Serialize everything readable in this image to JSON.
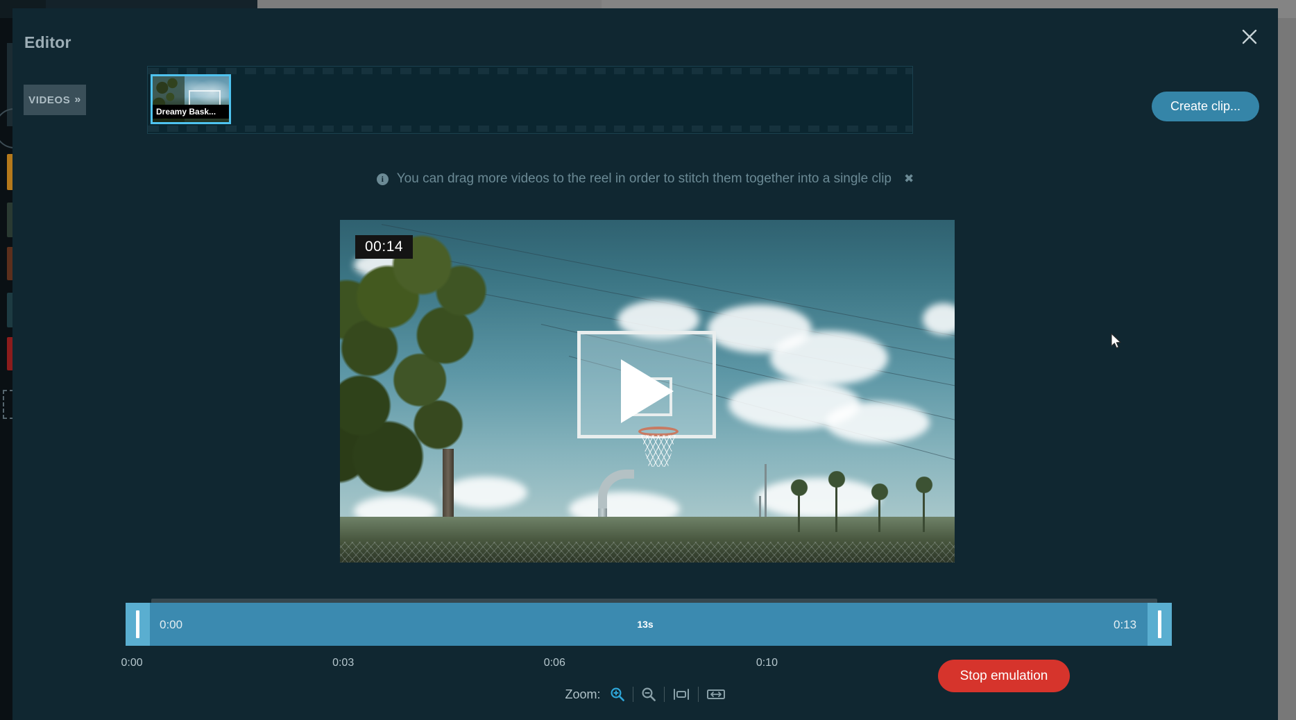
{
  "modal": {
    "title": "Editor",
    "close_icon": "close-icon"
  },
  "toolbar": {
    "videos_label": "VIDEOS",
    "videos_chevron": "»",
    "create_clip_label": "Create clip..."
  },
  "reel": {
    "items": [
      {
        "label": "Dreamy Bask...",
        "selected": true
      }
    ]
  },
  "info": {
    "icon": "info-icon",
    "message": "You can drag more videos to the reel in order to stitch them together into a single clip",
    "dismiss": "✖"
  },
  "player": {
    "timestamp": "00:14",
    "play_icon": "play-icon"
  },
  "timeline": {
    "start_label": "0:00",
    "end_label": "0:13",
    "duration_label": "13s",
    "ticks": [
      "0:00",
      "0:03",
      "0:06",
      "0:10"
    ],
    "tick_positions": [
      0.006,
      0.208,
      0.41,
      0.613
    ]
  },
  "actions": {
    "stop_emulation_label": "Stop emulation"
  },
  "zoom_controls": {
    "label": "Zoom:",
    "buttons": [
      {
        "name": "zoom-in-icon",
        "active": true
      },
      {
        "name": "zoom-out-icon",
        "active": false
      },
      {
        "name": "fit-window-icon",
        "active": false
      },
      {
        "name": "fit-width-icon",
        "active": false
      }
    ]
  },
  "colors": {
    "modal_bg": "#102731",
    "accent_blue": "#3585a8",
    "timeline_blue": "#3b8ab0",
    "handle_blue": "#5aaed0",
    "danger_red": "#d6342c",
    "thumb_border": "#4fc3ef"
  }
}
